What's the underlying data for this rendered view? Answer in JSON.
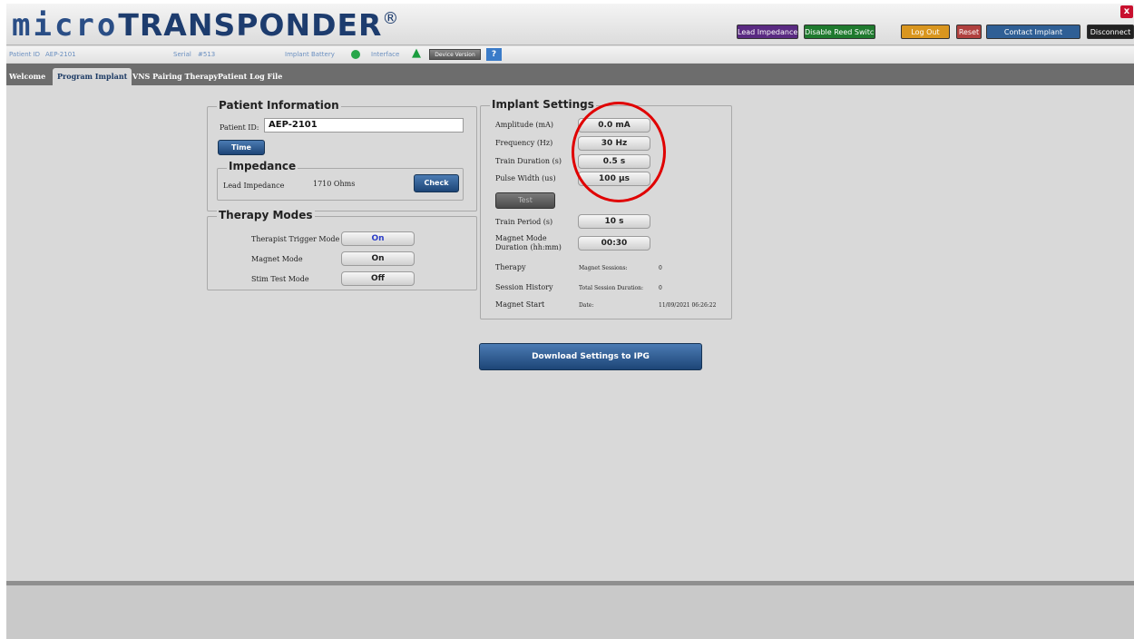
{
  "header": {
    "logo_micro": "micro",
    "logo_transponder": "TRANSPONDER",
    "logo_reg": "®",
    "close_label": "x",
    "buttons": {
      "lead_impedance": "Lead Impedance",
      "disable_reed_switch": "Disable Reed Switch",
      "log_out": "Log Out",
      "reset": "Reset",
      "contact_implant": "Contact Implant",
      "disconnect": "Disconnect"
    },
    "colors": {
      "lead_impedance": "#5a2a82",
      "disable_reed_switch": "#1f7a2e",
      "log_out": "#d9961f",
      "reset": "#b0403e",
      "contact_implant": "#2f5f95",
      "disconnect": "#222222"
    }
  },
  "info_bar": {
    "patient_id_label": "Patient ID",
    "patient_id_value": "AEP-2101",
    "serial_label": "Serial",
    "serial_value": "#513",
    "battery_label": "Implant Battery",
    "interface_label": "Interface",
    "device_version_label": "Device Version",
    "help_label": "?"
  },
  "tabs": {
    "welcome": "Welcome",
    "program_implant": "Program Implant",
    "vns_pairing": "VNS Pairing Therapy",
    "patient_log": "Patient Log File"
  },
  "patient_info": {
    "legend": "Patient Information",
    "patient_id_label": "Patient ID:",
    "patient_id_value": "AEP-2101",
    "time_button": "Time"
  },
  "impedance": {
    "legend": "Impedance",
    "lead_label": "Lead Impedance",
    "lead_value": "1710 Ohms",
    "check_button": "Check"
  },
  "therapy_modes": {
    "legend": "Therapy Modes",
    "therapist_trigger_label": "Therapist Trigger Mode",
    "therapist_trigger_value": "On",
    "magnet_mode_label": "Magnet Mode",
    "magnet_mode_value": "On",
    "stim_test_label": "Stim Test Mode",
    "stim_test_value": "Off"
  },
  "implant_settings": {
    "legend": "Implant Settings",
    "amplitude_label": "Amplitude (mA)",
    "amplitude_value": "0.0 mA",
    "frequency_label": "Frequency (Hz)",
    "frequency_value": "30 Hz",
    "train_duration_label": "Train Duration (s)",
    "train_duration_value": "0.5 s",
    "pulse_width_label": "Pulse Width (us)",
    "pulse_width_value": "100 µs",
    "test_button": "Test",
    "train_period_label": "Train Period (s)",
    "train_period_value": "10 s",
    "magnet_mode_duration_label_1": "Magnet Mode",
    "magnet_mode_duration_label_2": "Duration (hh:mm)",
    "magnet_mode_duration_value": "00:30",
    "therapy_label": "Therapy",
    "magnet_sessions_label": "Magnet Sessions:",
    "magnet_sessions_value": "0",
    "session_history_label": "Session History",
    "total_session_label": "Total Session Duration:",
    "total_session_value": "0",
    "magnet_start_label": "Magnet Start",
    "date_label": "Date:",
    "date_value": "11/09/2021 06:26:22"
  },
  "download_button": "Download Settings to IPG"
}
